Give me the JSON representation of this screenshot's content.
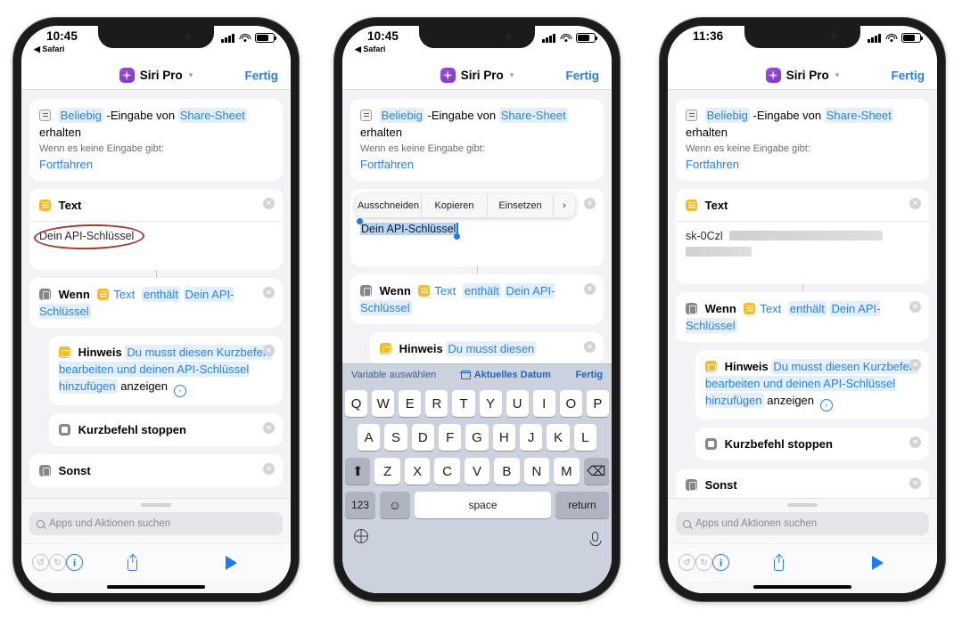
{
  "phones": [
    {
      "id": "phone-left",
      "status": {
        "time": "10:45",
        "back_label": "Safari"
      },
      "nav": {
        "app_title": "Siri Pro",
        "done_label": "Fertig"
      },
      "cards": {
        "input": {
          "token_any": "Beliebig",
          "mid_text": "-Eingabe von",
          "token_share": "Share-Sheet",
          "tail_text": "erhalten",
          "sub_label": "Wenn es keine Eingabe gibt:",
          "sub_value": "Fortfahren"
        },
        "text": {
          "title": "Text",
          "value": "Dein API-Schlüssel"
        },
        "if": {
          "keyword": "Wenn",
          "var": "Text",
          "operator": "enthält",
          "value": "Dein API-Schlüssel"
        },
        "note": {
          "title": "Hinweis",
          "message": "Du musst diesen Kurzbefehl bearbeiten und deinen API-Schlüssel hinzufügen",
          "show_label": "anzeigen"
        },
        "stop": {
          "title": "Kurzbefehl stoppen"
        },
        "else": {
          "title": "Sonst"
        }
      },
      "bottom": {
        "search_placeholder": "Apps und Aktionen suchen"
      }
    },
    {
      "id": "phone-middle",
      "status": {
        "time": "10:45",
        "back_label": "Safari"
      },
      "nav": {
        "app_title": "Siri Pro",
        "done_label": "Fertig"
      },
      "edit_menu": {
        "cut": "Ausschneiden",
        "copy": "Kopieren",
        "paste": "Einsetzen",
        "more": "›"
      },
      "selected_text": "Dein API-Schlüssel",
      "variable_bar": {
        "left": "Variable auswählen",
        "center": "Aktuelles Datum",
        "done": "Fertig"
      },
      "keyboard": {
        "row1": [
          "Q",
          "W",
          "E",
          "R",
          "T",
          "Y",
          "U",
          "I",
          "O",
          "P"
        ],
        "row2": [
          "A",
          "S",
          "D",
          "F",
          "G",
          "H",
          "J",
          "K",
          "L"
        ],
        "row3": [
          "Z",
          "X",
          "C",
          "V",
          "B",
          "N",
          "M"
        ],
        "shift": "⬆",
        "backspace": "⌫",
        "numbers": "123",
        "emoji": "☺",
        "space": "space",
        "return": "return"
      }
    },
    {
      "id": "phone-right",
      "status": {
        "time": "11:36",
        "back_label": ""
      },
      "nav": {
        "app_title": "Siri Pro",
        "done_label": "Fertig"
      },
      "cards": {
        "text": {
          "title": "Text",
          "value": "sk-0Czl"
        }
      },
      "bottom": {
        "search_placeholder": "Apps und Aktionen suchen"
      }
    }
  ],
  "shared": {
    "input_card": {
      "token_any": "Beliebig",
      "mid_text": "-Eingabe von",
      "token_share": "Share-Sheet",
      "tail_text": "erhalten",
      "sub_label": "Wenn es keine Eingabe gibt:",
      "sub_value": "Fortfahren"
    },
    "if_card": {
      "keyword": "Wenn",
      "var": "Text",
      "operator": "enthält",
      "value": "Dein API-Schlüssel"
    },
    "note_card": {
      "title": "Hinweis",
      "msg_part1": "Du musst diesen",
      "msg_part2": "Kurzbefehl bearbeiten und deinen API-",
      "msg_part3": "Schlüssel hinzufügen",
      "show_label": "anzeigen"
    },
    "stop_card": {
      "title": "Kurzbefehl stoppen"
    },
    "else_card": {
      "title": "Sonst"
    },
    "text_card_title": "Text",
    "search_placeholder": "Apps und Aktionen suchen"
  },
  "colors": {
    "accent_blue": "#2a7fee",
    "token_blue_bg": "#e2effd",
    "annotation_red": "#a8342a",
    "icon_yellow": "#f5b92a",
    "icon_gray": "#86868c",
    "siri_purple": "#8137c9"
  }
}
